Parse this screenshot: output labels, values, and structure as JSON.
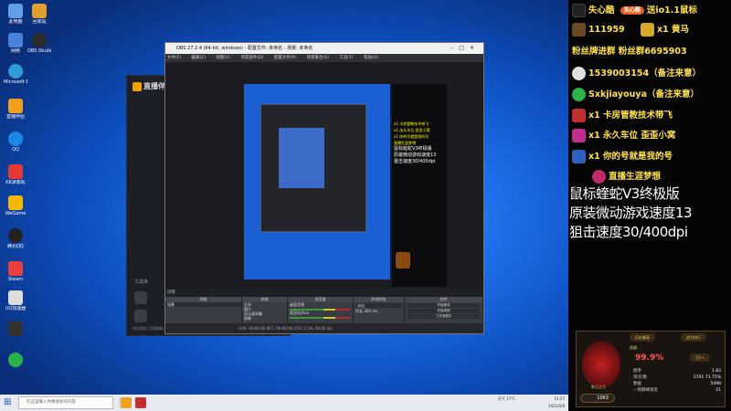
{
  "desktop": {
    "icons": [
      {
        "label": "此电脑",
        "color": "#5fa0e8"
      },
      {
        "label": "回收站",
        "color": "#8fb8e8"
      },
      {
        "label": "网络",
        "color": "#4a82d8"
      },
      {
        "label": "OBS Studio",
        "color": "#2c2c2c"
      },
      {
        "label": "Microsoft Edge",
        "color": "#2e9bd6"
      },
      {
        "label": "直播伴侣",
        "color": "#f0a020"
      },
      {
        "label": "QQ",
        "color": "#1e88e5"
      },
      {
        "label": "KK录像机",
        "color": "#e53935"
      },
      {
        "label": "WeGame",
        "color": "#f5b800"
      },
      {
        "label": "腾讯QQ",
        "color": "#222"
      },
      {
        "label": "Steam",
        "color": "#1b2838"
      },
      {
        "label": "UU加速器",
        "color": "#2ab34a"
      }
    ]
  },
  "bg_app": {
    "title": "直播伴侣",
    "tools_label": "工具库",
    "version": "伴侣版本 已是最新"
  },
  "obs": {
    "title": "OBS 27.2.4 (64-bit, windows) - 配置文件: 未命名 - 场景: 未命名",
    "menu": [
      "文件(F)",
      "编辑(E)",
      "视图(V)",
      "停靠部件(D)",
      "配置文件(P)",
      "场景集合(S)",
      "工具(T)",
      "帮助(H)"
    ],
    "preview_panel_lines": [
      "x1 卡房管教技术带飞",
      "x1 永久车位 歪歪小窝",
      "x1 你的号就是我的号",
      "直播生涯梦想"
    ],
    "preview_panel_big": [
      "鼠标蝰蛇V3终极版",
      "原装微动游戏速度13",
      "狙击速度30/400dpi"
    ],
    "dock_header": [
      "场景",
      "来源",
      "混音器",
      "转场特效",
      "控件"
    ],
    "scenes": {
      "title": "场景",
      "item": "场景"
    },
    "sources": {
      "title": "来源",
      "items": [
        "文本",
        "文本",
        "文本",
        "图片",
        "显示器采集",
        "图像"
      ]
    },
    "mixer": {
      "title": "混音器",
      "items": [
        "桌面音频",
        "麦克风/Aux"
      ],
      "levels": [
        "0.0 dB",
        "0.0 dB"
      ]
    },
    "transitions": {
      "title": "转场特效",
      "fade": "淡出",
      "duration_label": "时长",
      "duration": "300 ms"
    },
    "controls": {
      "title": "控件",
      "buttons": [
        "开始推流",
        "开始录制",
        "启动虚拟摄像机",
        "工作室模式",
        "设置",
        "退出"
      ]
    },
    "status": "LIVE: 00:00:00   REC: 00:00:00   CPU: 2.1%, 60.00 fps"
  },
  "taskbar": {
    "search_placeholder": "在这里输入你要搜索的内容",
    "tray_text": "天气 17°C",
    "time": "14:27",
    "date": "2022/6/8"
  },
  "overlay": {
    "rows": [
      {
        "icon": "tiktok-icon",
        "color": "#111",
        "text": "失心酷",
        "extra": "送io1.1鼠标",
        "badge": "失心酷"
      },
      {
        "icon": "gift-icon",
        "color": "#6a4a20",
        "text": "111959",
        "extra": "x1 黄马"
      },
      {
        "icon": "fans-icon",
        "color": "#2e8b3a",
        "text": "粉丝牌进",
        "extra": "群    粉丝群6695903"
      },
      {
        "icon": "qq-icon",
        "color": "#e0e0e0",
        "text": "1539003154（备注来意）"
      },
      {
        "icon": "wechat-icon",
        "color": "#2db14a",
        "text": "Sxkjiayouya（备注来意）"
      },
      {
        "icon": "rocket-icon",
        "color": "#c03030",
        "text": "x1 卡房管教技术带飞"
      },
      {
        "icon": "crown-icon",
        "color": "#c0308a",
        "text": "x1 永久车位 歪歪小窝"
      },
      {
        "icon": "plane-icon",
        "color": "#3060c0",
        "text": "x1 你的号就是我的号"
      },
      {
        "icon": "dream-icon",
        "color": "#c02a6a",
        "text": "直播生涯梦想"
      }
    ],
    "big_lines": [
      "鼠标蝰蛇V3终极版",
      "原装微动游戏速度13",
      "狙击速度30/400dpi"
    ],
    "rank": {
      "tags": [
        "历史最高",
        "战力排行",
        "1万+"
      ],
      "pct_label": "超越",
      "pct": "99.9%",
      "title": "新王之王",
      "score": "1063",
      "stats": [
        {
          "label": "胜率",
          "value": "1.83"
        },
        {
          "label": "场次/胜",
          "value": "5741 71.75%"
        },
        {
          "label": "数据",
          "value": "5498"
        },
        {
          "label": "一周巅峰排名",
          "value": "21"
        }
      ]
    }
  }
}
